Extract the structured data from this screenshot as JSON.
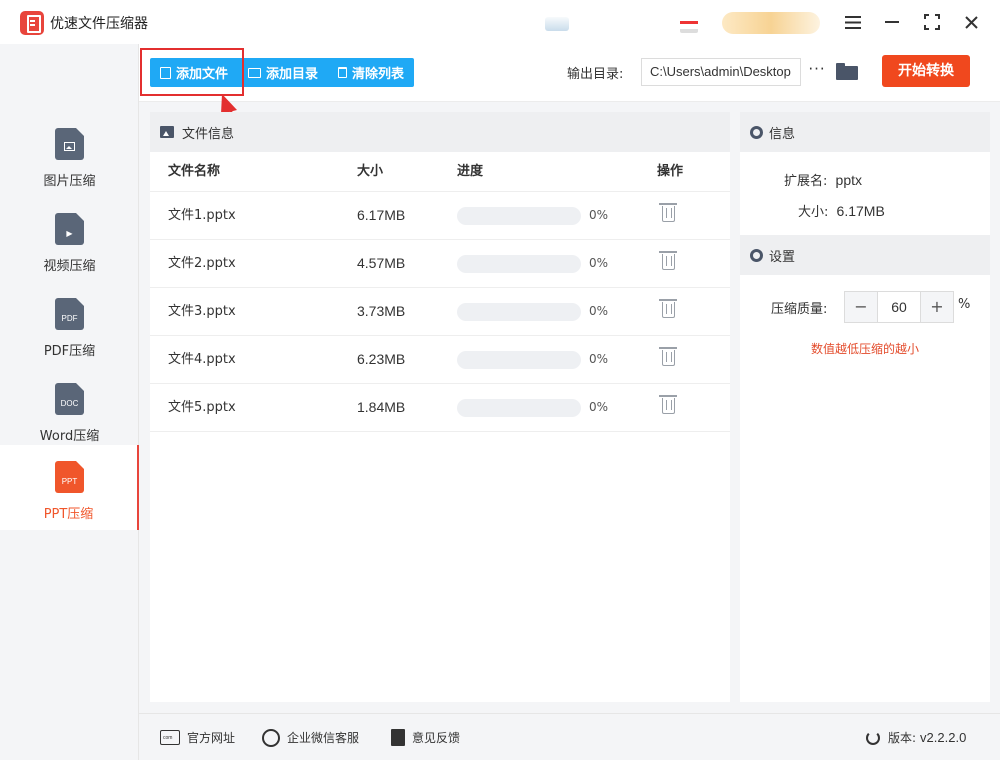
{
  "app": {
    "title": "优速文件压缩器"
  },
  "sidebar": {
    "items": [
      {
        "label": "图片压缩",
        "icon_text": "",
        "icon": "image-file-icon"
      },
      {
        "label": "视频压缩",
        "icon_text": "▶",
        "icon": "video-file-icon"
      },
      {
        "label": "PDF压缩",
        "icon_text": "PDF",
        "icon": "pdf-file-icon"
      },
      {
        "label": "Word压缩",
        "icon_text": "DOC",
        "icon": "doc-file-icon"
      },
      {
        "label": "PPT压缩",
        "icon_text": "PPT",
        "icon": "ppt-file-icon"
      }
    ],
    "active_index": 4
  },
  "toolbar": {
    "add_file_label": "添加文件",
    "add_folder_label": "添加目录",
    "clear_list_label": "清除列表",
    "output_label": "输出目录:",
    "output_path": "C:\\Users\\admin\\Desktop",
    "more_label": "···",
    "start_label": "开始转换"
  },
  "file_panel": {
    "title": "文件信息",
    "columns": {
      "name": "文件名称",
      "size": "大小",
      "progress": "进度",
      "action": "操作"
    },
    "rows": [
      {
        "name": "文件1.pptx",
        "size": "6.17MB",
        "progress_pct": 0,
        "progress_text": "0%"
      },
      {
        "name": "文件2.pptx",
        "size": "4.57MB",
        "progress_pct": 0,
        "progress_text": "0%"
      },
      {
        "name": "文件3.pptx",
        "size": "3.73MB",
        "progress_pct": 0,
        "progress_text": "0%"
      },
      {
        "name": "文件4.pptx",
        "size": "6.23MB",
        "progress_pct": 0,
        "progress_text": "0%"
      },
      {
        "name": "文件5.pptx",
        "size": "1.84MB",
        "progress_pct": 0,
        "progress_text": "0%"
      }
    ]
  },
  "info_panel": {
    "title": "信息",
    "ext_label": "扩展名:",
    "ext_value": "pptx",
    "size_label": "大小:",
    "size_value": "6.17MB"
  },
  "settings_panel": {
    "title": "设置",
    "quality_label": "压缩质量:",
    "minus_label": "−",
    "quality_value": "60",
    "plus_label": "+",
    "unit": "%",
    "hint": "数值越低压缩的越小"
  },
  "footer": {
    "website_label": "官方网址",
    "wechat_label": "企业微信客服",
    "feedback_label": "意见反馈",
    "version_label": "版本:",
    "version_value": "v2.2.2.0"
  },
  "colors": {
    "accent_blue": "#1fa9f5",
    "start_orange": "#f0481e",
    "active_orange": "#f0562b",
    "highlight_red": "#e32f2f",
    "hint_red": "#e34c2c"
  }
}
